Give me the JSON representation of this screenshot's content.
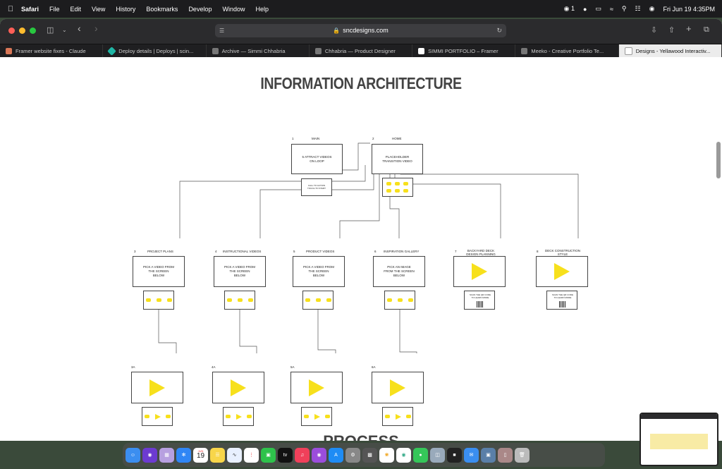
{
  "menubar": {
    "app": "Safari",
    "items": [
      "File",
      "Edit",
      "View",
      "History",
      "Bookmarks",
      "Develop",
      "Window",
      "Help"
    ],
    "status": {
      "notifications": "1",
      "datetime": "Fri Jun 19  4:35PM"
    }
  },
  "browser": {
    "url": "sncdesigns.com",
    "tabs": [
      {
        "label": "Framer website fixes - Claude",
        "color": "#d97757"
      },
      {
        "label": "Deploy details | Deploys | scin...",
        "color": "#1fb6a5"
      },
      {
        "label": "Archive — Simmi Chhabria",
        "color": "#777777"
      },
      {
        "label": "Chhabria — Product Designer",
        "color": "#777777"
      },
      {
        "label": "SIMMI PORTFOLIO – Framer",
        "color": "#ffffff"
      },
      {
        "label": "Meeko - Creative Portfolio Te...",
        "color": "#777777"
      },
      {
        "label": "Designs - Yellawood Interactiv...",
        "color": "#ffffff",
        "active": true
      }
    ]
  },
  "page": {
    "title": "INFORMATION ARCHITECTURE",
    "next_section": "PROCESS"
  },
  "diagram": {
    "main": {
      "num": "1",
      "label": "MAIN",
      "box": "5 ATTRACT VIDEOS ON LOOP",
      "sub": "CALL TO ACTION TOUCH TO START"
    },
    "home": {
      "num": "2",
      "label": "HOME",
      "box": "PLACEHOLDER TRANSITION VIDEO"
    },
    "sections": [
      {
        "num": "3",
        "label": "PROJECT PLANS",
        "box": "PICK A VIDEO FROM THE SCREEN BELOW",
        "sub_num": "3A"
      },
      {
        "num": "4",
        "label": "INSTRUCTIONAL VIDEOS",
        "box": "PICK A VIDEO FROM THE SCREEN BELOW",
        "sub_num": "4A"
      },
      {
        "num": "5",
        "label": "PRODUCT VIDEOS",
        "box": "PICK A VIDEO FROM THE SCREEN BELOW",
        "sub_num": "5A"
      },
      {
        "num": "6",
        "label": "INSPIRATION GALLERY",
        "box": "PICK AN IMAGE FROM THE SCREEN BELOW",
        "sub_num": "6A"
      },
      {
        "num": "7",
        "label": "BACKYARD DECK DESIGN PLANNING",
        "qr_text": "SCAN THE QR CODE TO LEARN MORE"
      },
      {
        "num": "8",
        "label": "DECK CONSTRUCTION STYLE",
        "qr_text": "SCAN THE QR CODE TO LEARN MORE"
      }
    ]
  },
  "dock": {
    "calendar_day": "19",
    "calendar_month": "JUN"
  },
  "colors": {
    "accent_yellow": "#f7e01c"
  }
}
